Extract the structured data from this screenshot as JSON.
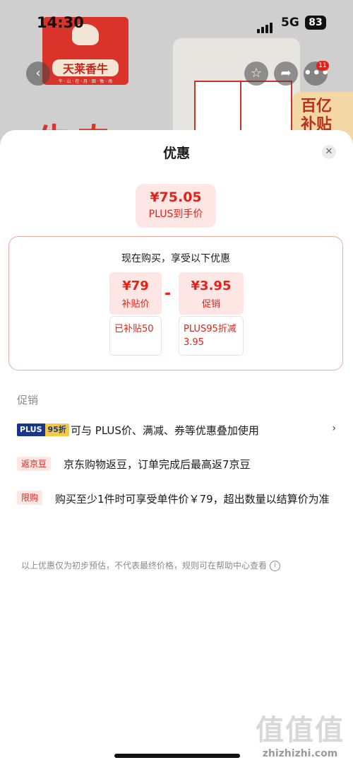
{
  "status_bar": {
    "time": "14:30",
    "network": "5G",
    "battery": "83"
  },
  "background": {
    "brand_name": "天莱香牛",
    "brand_subtitle": "牛 · 山 · 在 · 月 · 田 · 牧 · 场",
    "hero_text": "牛肉",
    "promo_badge": "百亿补贴",
    "cart_badge": "11",
    "icons": {
      "back": "chevron-left-icon",
      "favorite": "star-icon",
      "share": "share-icon",
      "more": "more-icon"
    }
  },
  "sheet": {
    "title": "优惠",
    "final": {
      "price": "¥75.05",
      "label": "PLUS到手价"
    },
    "calc": {
      "title": "现在购买，享受以下优惠",
      "base": {
        "price": "¥79",
        "label": "补贴价",
        "note": "已补贴50"
      },
      "operator": "-",
      "discount": {
        "price": "¥3.95",
        "label": "促销",
        "note": "PLUS95折减3.95"
      }
    },
    "section_label": "促销",
    "promos": [
      {
        "tag_a": "PLUS",
        "tag_b": "95折",
        "text": "可与 PLUS价、满减、券等优惠叠加使用",
        "has_chevron": true
      },
      {
        "tag": "返京豆",
        "text": "京东购物返豆，订单完成后最高返7京豆"
      },
      {
        "tag": "限购",
        "text": "购买至少1件时可享受单件价￥79，超出数量以结算价为准"
      }
    ],
    "disclaimer": "以上优惠仅为初步预估，不代表最终价格，规则可在帮助中心查看"
  },
  "watermark": {
    "mark": "值值值",
    "site": "zhizhizhi.com"
  },
  "colors": {
    "accent": "#e2231a",
    "pill_bg": "#fde6e4",
    "plus_blue": "#19368c",
    "plus_gold": "#f6c945"
  }
}
